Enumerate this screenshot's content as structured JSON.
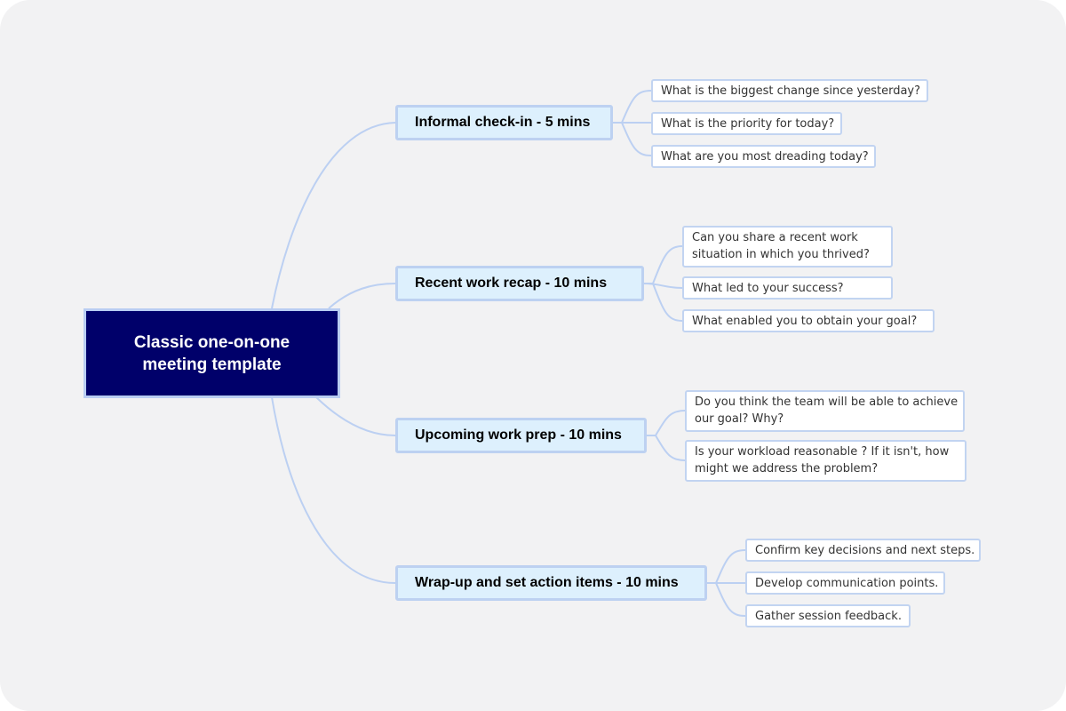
{
  "central": {
    "title": "Classic one-on-one meeting template"
  },
  "branches": [
    {
      "label": "Informal check-in - 5 mins",
      "children": [
        {
          "text": "What is the biggest change since yesterday?"
        },
        {
          "text": "What is the priority for today?"
        },
        {
          "text": "What are you most dreading today?"
        }
      ]
    },
    {
      "label": "Recent work recap - 10 mins",
      "children": [
        {
          "line1": "Can you share a recent work",
          "line2": "situation in which you thrived?"
        },
        {
          "text": "What led to your success?"
        },
        {
          "text": "What enabled you to obtain your goal?"
        }
      ]
    },
    {
      "label": "Upcoming work prep - 10 mins",
      "children": [
        {
          "line1": "Do you think the team will be able to achieve",
          "line2": "our goal?  Why?"
        },
        {
          "line1": "Is your workload reasonable ? If it isn't, how",
          "line2": "might we address the problem?"
        }
      ]
    },
    {
      "label": "Wrap-up and set action items - 10 mins",
      "children": [
        {
          "text": "Confirm key decisions and next steps."
        },
        {
          "text": "Develop communication points."
        },
        {
          "text": "Gather session feedback."
        }
      ]
    }
  ],
  "colors": {
    "background": "#f2f2f3",
    "central_fill": "#00006a",
    "branch_fill": "#ddf0fd",
    "connector": "#bcd0f2"
  }
}
